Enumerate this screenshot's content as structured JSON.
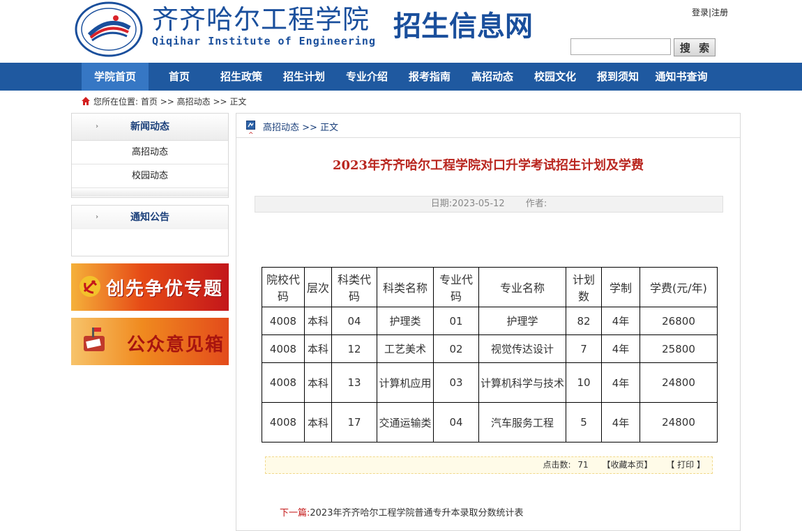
{
  "header": {
    "school_cn": "齐齐哈尔工程学院",
    "school_en": "Qiqihar Institute of Engineering",
    "site_name": "招生信息网",
    "login_label": "登录",
    "register_label": "注册",
    "search_placeholder": "",
    "search_button": "搜 索"
  },
  "nav": {
    "items": [
      "学院首页",
      "首页",
      "招生政策",
      "招生计划",
      "专业介绍",
      "报考指南",
      "高招动态",
      "校园文化",
      "报到须知",
      "通知书查询"
    ]
  },
  "breadcrumb": {
    "prefix": "您所在位置:",
    "home": "首页",
    "section": "高招动态",
    "current": "正文",
    "sep": ">>"
  },
  "sidebar": {
    "news": {
      "title": "新闻动态",
      "items": [
        "高招动态",
        "校园动态"
      ]
    },
    "notice": {
      "title": "通知公告"
    },
    "banners": [
      "创先争优专题",
      "公众意见箱"
    ]
  },
  "main": {
    "head_section": "高招动态",
    "head_current": "正文",
    "title": "2023年齐齐哈尔工程学院对口升学考试招生计划及学费",
    "date_label": "日期:",
    "date": "2023-05-12",
    "author_label": "作者:",
    "table": {
      "headers": [
        "院校代码",
        "层次",
        "科类代码",
        "科类名称",
        "专业代码",
        "专业名称",
        "计划数",
        "学制",
        "学费(元/年)"
      ],
      "rows": [
        [
          "4008",
          "本科",
          "04",
          "护理类",
          "01",
          "护理学",
          "82",
          "4年",
          "26800"
        ],
        [
          "4008",
          "本科",
          "12",
          "工艺美术",
          "02",
          "视觉传达设计",
          "7",
          "4年",
          "25800"
        ],
        [
          "4008",
          "本科",
          "13",
          "计算机应用",
          "03",
          "计算机科学与技术",
          "10",
          "4年",
          "24800"
        ],
        [
          "4008",
          "本科",
          "17",
          "交通运输类",
          "04",
          "汽车服务工程",
          "5",
          "4年",
          "24800"
        ]
      ]
    },
    "tools": {
      "clicks_label": "点击数:",
      "clicks": "71",
      "favorite": "【收藏本页】",
      "print": "【 打印 】"
    },
    "next_label": "下一篇:",
    "next_title": "2023年齐齐哈尔工程学院普通专升本录取分数统计表"
  },
  "colors": {
    "nav_bg": "#1f59a0",
    "nav_active": "#3677c4",
    "title_red": "#b9261f",
    "brand_blue": "#1a4f9c"
  }
}
